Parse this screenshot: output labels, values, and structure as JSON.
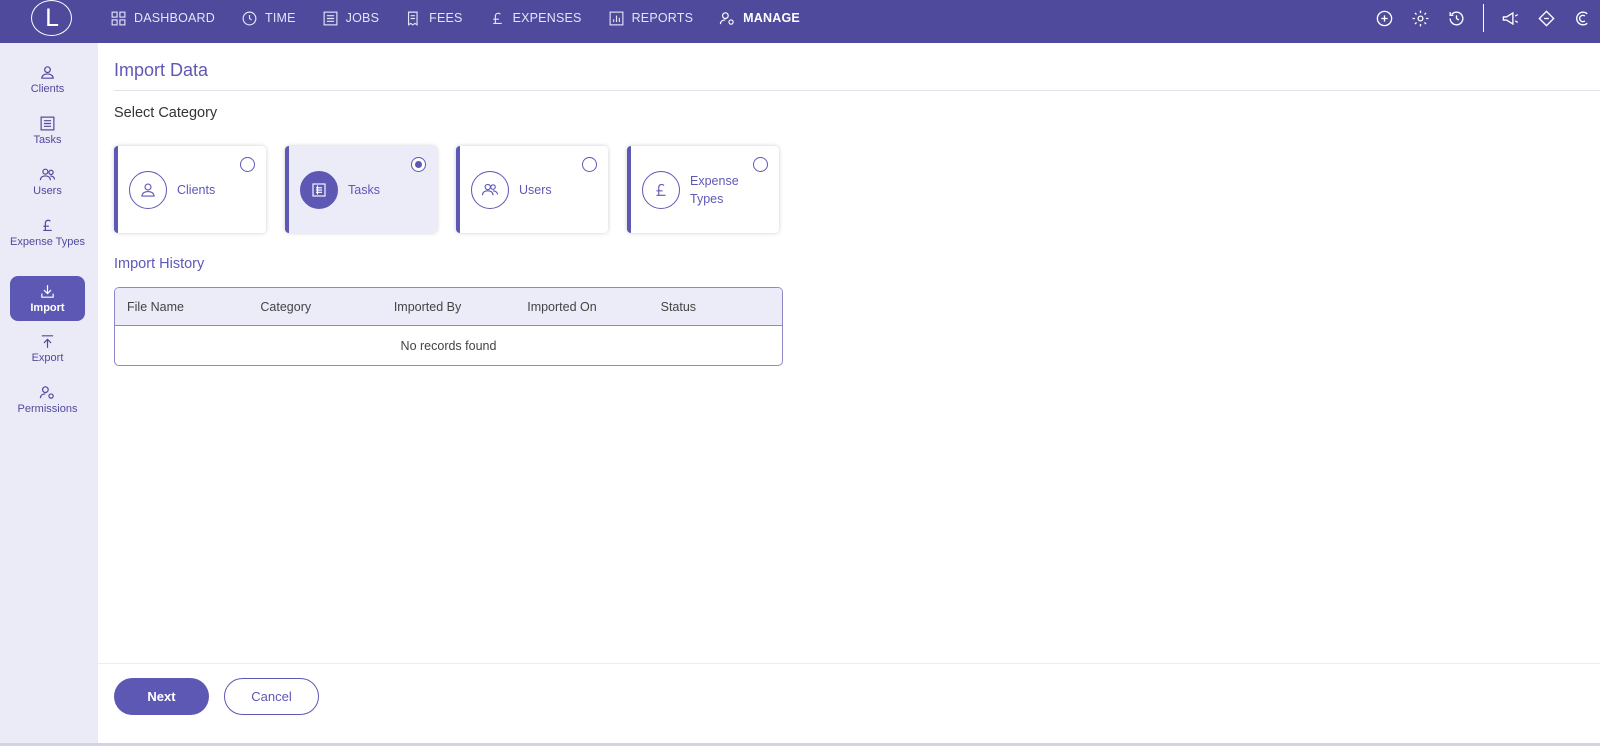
{
  "topbar": {
    "logo_letter": "L",
    "nav": [
      {
        "label": "DASHBOARD",
        "icon": "grid-icon"
      },
      {
        "label": "TIME",
        "icon": "clock-icon"
      },
      {
        "label": "JOBS",
        "icon": "list-icon"
      },
      {
        "label": "FEES",
        "icon": "receipt-icon"
      },
      {
        "label": "EXPENSES",
        "icon": "pound-icon"
      },
      {
        "label": "REPORTS",
        "icon": "bar-chart-icon"
      },
      {
        "label": "MANAGE",
        "icon": "user-gear-icon",
        "active": true
      }
    ],
    "right_icons": [
      "add-circle-icon",
      "settings-icon",
      "history-icon",
      "announcement-icon",
      "ticket-icon",
      "profile-c-icon"
    ]
  },
  "sidebar": {
    "items": [
      {
        "label": "Clients",
        "icon": "person-icon"
      },
      {
        "label": "Tasks",
        "icon": "task-list-icon"
      },
      {
        "label": "Users",
        "icon": "users-icon"
      },
      {
        "label": "Expense Types",
        "icon": "pound-icon"
      },
      {
        "label": "Import",
        "icon": "import-icon",
        "active": true
      },
      {
        "label": "Export",
        "icon": "export-icon"
      },
      {
        "label": "Permissions",
        "icon": "user-gear-icon"
      }
    ]
  },
  "main": {
    "title": "Import Data",
    "select_category": "Select Category",
    "categories": [
      {
        "label": "Clients",
        "icon": "person-icon",
        "selected": false
      },
      {
        "label": "Tasks",
        "icon": "task-list-icon",
        "selected": true
      },
      {
        "label": "Users",
        "icon": "users-icon",
        "selected": false
      },
      {
        "label": "Expense Types",
        "icon": "pound-icon",
        "selected": false
      }
    ],
    "history_title": "Import History",
    "table": {
      "columns": [
        "File Name",
        "Category",
        "Imported By",
        "Imported On",
        "Status"
      ],
      "empty_text": "No records found"
    }
  },
  "footer": {
    "next_label": "Next",
    "cancel_label": "Cancel"
  },
  "colors": {
    "topbar": "#4f4a9c",
    "accent": "#5e58b5",
    "sidebar_bg": "#ebeaf7"
  }
}
